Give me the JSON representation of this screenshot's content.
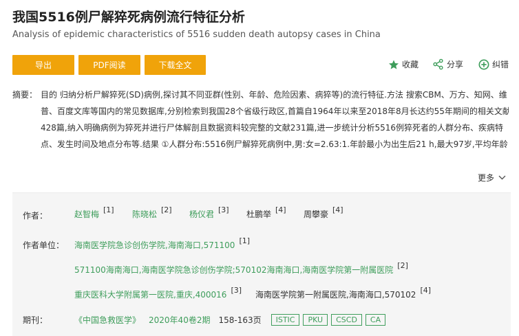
{
  "article": {
    "title": "我国5516例尸解猝死病例流行特征分析",
    "subtitle": "Analysis of epidemic characteristics of 5516 sudden death autopsy cases in China"
  },
  "buttons": {
    "export": "导出",
    "pdf": "PDF阅读",
    "download": "下载全文"
  },
  "actions": {
    "favorite": "收藏",
    "share": "分享",
    "report": "纠错"
  },
  "abstract": {
    "label": "摘要：",
    "lines": [
      "目的 归纳分析尸解猝死(SD)病例,探讨其不同亚群(性别、年龄、危险因素、病猝等)的流行特征.方法 搜索CBM、万方、知网、维",
      "普、百度文库等国内的常见数据库,分别检索到我国28个省级行政区,首篇自1964年以来至2018年8月长达约55年期间的相关文献",
      "428篇,纳入明确病例为猝死并进行尸体解剖且数据资料较完整的文献231篇,进一步统计分析5516例猝死者的人群分布、疾病特",
      "点、发生时间及地点分布等.结果 ①人群分布:5516例尸解猝死病例中,男:女=2.63:1.年龄最小为出生后21 h,最大97岁,平均年龄"
    ],
    "more": "更多"
  },
  "info": {
    "authors_label": "作者：",
    "authors": [
      {
        "name": "赵智梅",
        "sup": "[1]",
        "linked": true
      },
      {
        "name": "陈晓松",
        "sup": "[2]",
        "linked": true
      },
      {
        "name": "杨仪君",
        "sup": "[3]",
        "linked": true
      },
      {
        "name": "杜鹏举",
        "sup": "[4]",
        "linked": false
      },
      {
        "name": "周攀豪",
        "sup": "[4]",
        "linked": false
      }
    ],
    "units_label": "作者单位：",
    "units": [
      {
        "name": "海南医学院急诊创伤学院,海南海口,571100",
        "sup": "[1]",
        "linked": true
      },
      {
        "name": "571100海南海口,海南医学院急诊创伤学院;570102海南海口,海南医学院第一附属医院",
        "sup": "[2]",
        "linked": true
      },
      {
        "name": "重庆医科大学附属第一医院,重庆,400016",
        "sup": "[3]",
        "linked": true
      },
      {
        "name": "海南医学院第一附属医院,海南海口,570102",
        "sup": "[4]",
        "linked": false
      }
    ],
    "journal_label": "期刊：",
    "journal": "《中国急救医学》",
    "issue": "2020年40卷2期",
    "pages": "158-163页",
    "tags": [
      "ISTIC",
      "PKU",
      "CSCD",
      "CA"
    ]
  }
}
